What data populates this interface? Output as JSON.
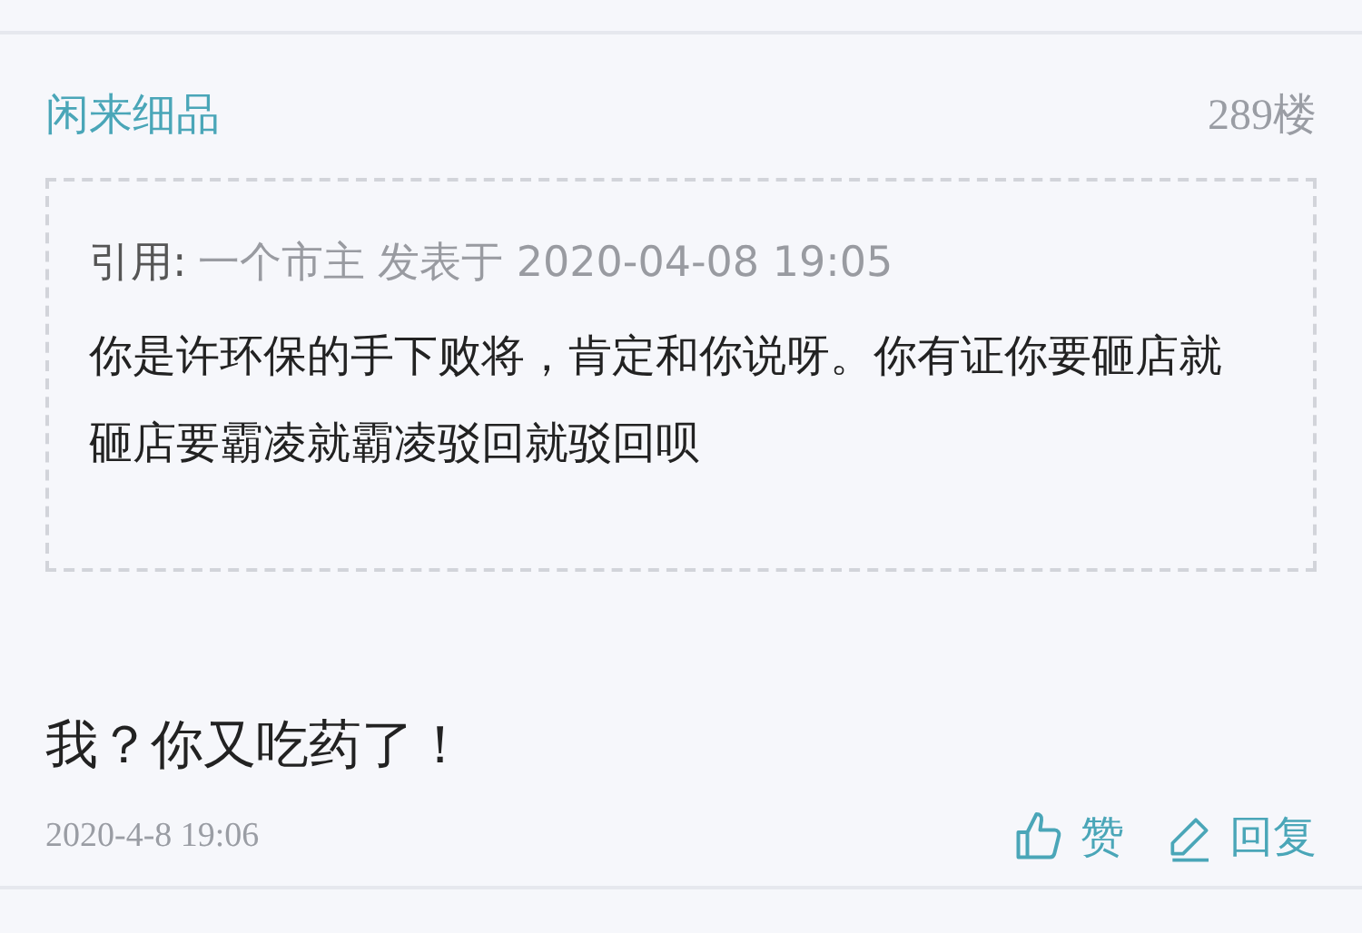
{
  "post": {
    "author": "闲来细品",
    "floor": "289楼",
    "quote": {
      "label": "引用:",
      "meta": "一个市主 发表于 2020-04-08 19:05",
      "text": "你是许环保的手下败将，肯定和你说呀。你有证你要砸店就砸店要霸凌就霸凌驳回就驳回呗"
    },
    "body": "我？你又吃药了！",
    "time": "2020-4-8 19:06",
    "actions": [
      {
        "kind": "like",
        "label": "赞"
      },
      {
        "kind": "reply",
        "label": "回复"
      }
    ]
  }
}
